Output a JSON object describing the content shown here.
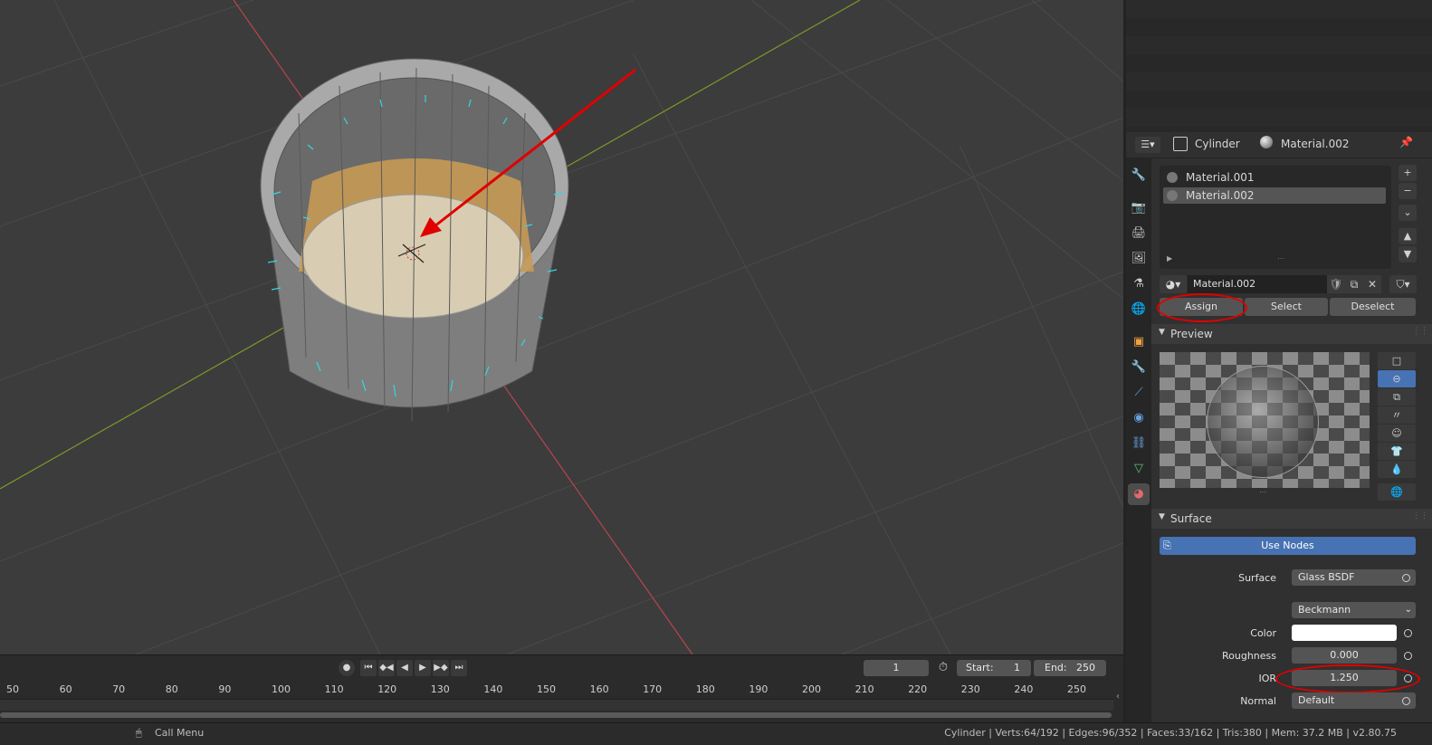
{
  "viewport": {
    "name": "3d-viewport",
    "object": "Cylinder"
  },
  "timeline": {
    "current_frame": "1",
    "start_label": "Start:",
    "start_value": "1",
    "end_label": "End:",
    "end_value": "250",
    "ruler": [
      "50",
      "60",
      "70",
      "80",
      "90",
      "100",
      "110",
      "120",
      "130",
      "140",
      "150",
      "160",
      "170",
      "180",
      "190",
      "200",
      "210",
      "220",
      "230",
      "240",
      "250"
    ],
    "controls": [
      "●",
      "⏮",
      "◆◀",
      "◀",
      "▶",
      "▶◆",
      "⏭"
    ]
  },
  "statusbar": {
    "call_menu": "Call Menu",
    "stats": "Cylinder | Verts:64/192 | Edges:96/352 | Faces:33/162 | Tris:380 | Mem: 37.2 MB | v2.80.75"
  },
  "properties": {
    "header": {
      "object_name": "Cylinder",
      "material_name": "Material.002"
    },
    "slots": [
      {
        "label": "Material.001",
        "selected": false
      },
      {
        "label": "Material.002",
        "selected": true
      }
    ],
    "material_field": "Material.002",
    "assign_label": "Assign",
    "select_label": "Select",
    "deselect_label": "Deselect",
    "preview_title": "Preview",
    "surface_title": "Surface",
    "use_nodes_label": "Use Nodes",
    "surface_label": "Surface",
    "surface_value": "Glass BSDF",
    "distribution_value": "Beckmann",
    "color_label": "Color",
    "color_value": "#ffffff",
    "roughness_label": "Roughness",
    "roughness_value": "0.000",
    "ior_label": "IOR",
    "ior_value": "1.250",
    "normal_label": "Normal",
    "normal_value": "Default"
  },
  "colors": {
    "accent": "#4772b3",
    "highlight_annotation": "#e00000",
    "axis_x": "#c0424a",
    "axis_y": "#7a9a2a"
  }
}
